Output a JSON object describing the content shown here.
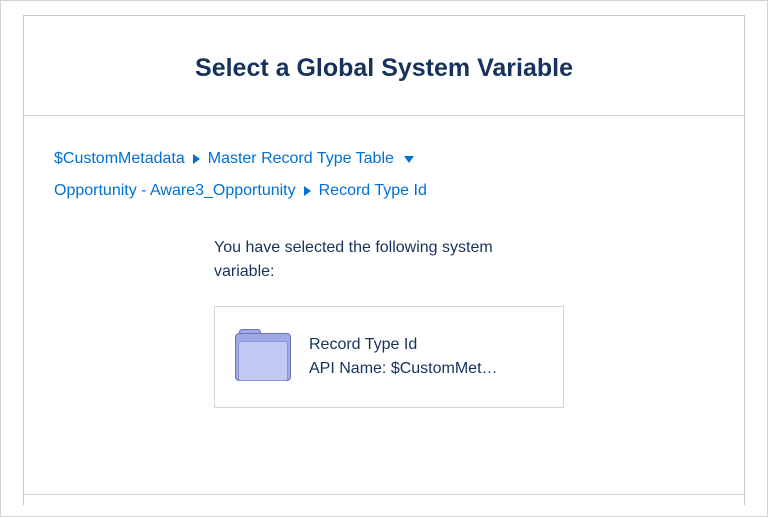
{
  "header": {
    "title": "Select a Global System Variable"
  },
  "breadcrumb": {
    "row1": {
      "item1": "$CustomMetadata",
      "item2": "Master Record Type Table"
    },
    "row2": {
      "item1": "Opportunity - Aware3_Opportunity",
      "item2": "Record Type Id"
    }
  },
  "selected": {
    "intro": "You have selected the following system variable:",
    "label": "Record Type Id",
    "api_prefix": "API Name: ",
    "api_value": "$CustomMet…"
  }
}
